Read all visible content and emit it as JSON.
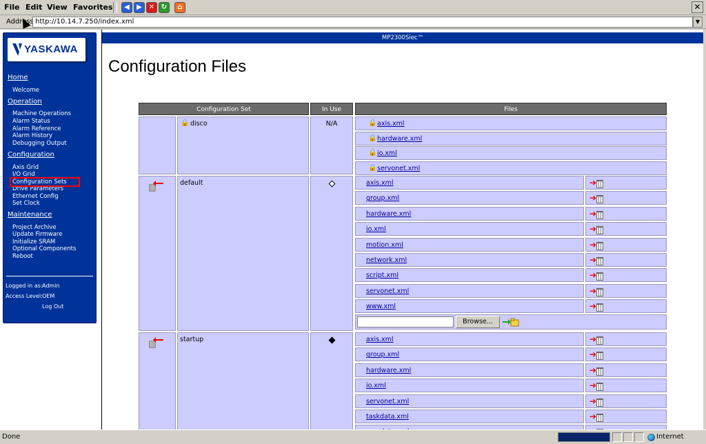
{
  "browser": {
    "menu": [
      "File",
      "Edit",
      "View",
      "Favorites"
    ],
    "address_label": "Address",
    "address_value": "http://10.14.7.250/index.xml",
    "status_text": "Done",
    "zone_label": "Internet"
  },
  "header": {
    "device_name": "MP2300Siec™"
  },
  "logo": {
    "text": "YASKAWA"
  },
  "sidebar": {
    "home": {
      "title": "Home",
      "items": [
        "Welcome"
      ]
    },
    "operation": {
      "title": "Operation",
      "items": [
        "Machine Operations",
        "Alarm Status",
        "Alarm Reference",
        "Alarm History",
        "Debugging Output"
      ]
    },
    "configuration": {
      "title": "Configuration",
      "items": [
        "Axis Grid",
        "I/O Grid",
        "Configuration Sets",
        "Drive Parameters",
        "Ethernet Config",
        "Set Clock"
      ]
    },
    "maintenance": {
      "title": "Maintenance",
      "items": [
        "Project Archive",
        "Update Firmware",
        "Initialize SRAM",
        "Optional Components",
        "Reboot"
      ]
    },
    "logged_in_label": "Logged in as:",
    "logged_in_value": "Admin",
    "access_label": "Access Level:",
    "access_value": "OEM",
    "logout": "Log Out"
  },
  "main": {
    "title": "Configuration Files",
    "columns": [
      "Configuration Set",
      "In Use",
      "Files"
    ],
    "sets": [
      {
        "name": "disco",
        "in_use": "N/A",
        "files": [
          "axis.xml",
          "hardware.xml",
          "io.xml",
          "servonet.xml"
        ]
      },
      {
        "name": "default",
        "in_use": "",
        "files": [
          "axis.xml",
          "group.xml",
          "hardware.xml",
          "io.xml",
          "motion.xml",
          "network.xml",
          "script.xml",
          "servonet.xml",
          "www.xml"
        ]
      },
      {
        "name": "startup",
        "in_use": "",
        "files": [
          "axis.xml",
          "group.xml",
          "hardware.xml",
          "io.xml",
          "servonet.xml",
          "taskdata.xml",
          "userdata.xml"
        ]
      }
    ],
    "browse_label": "Browse..."
  }
}
